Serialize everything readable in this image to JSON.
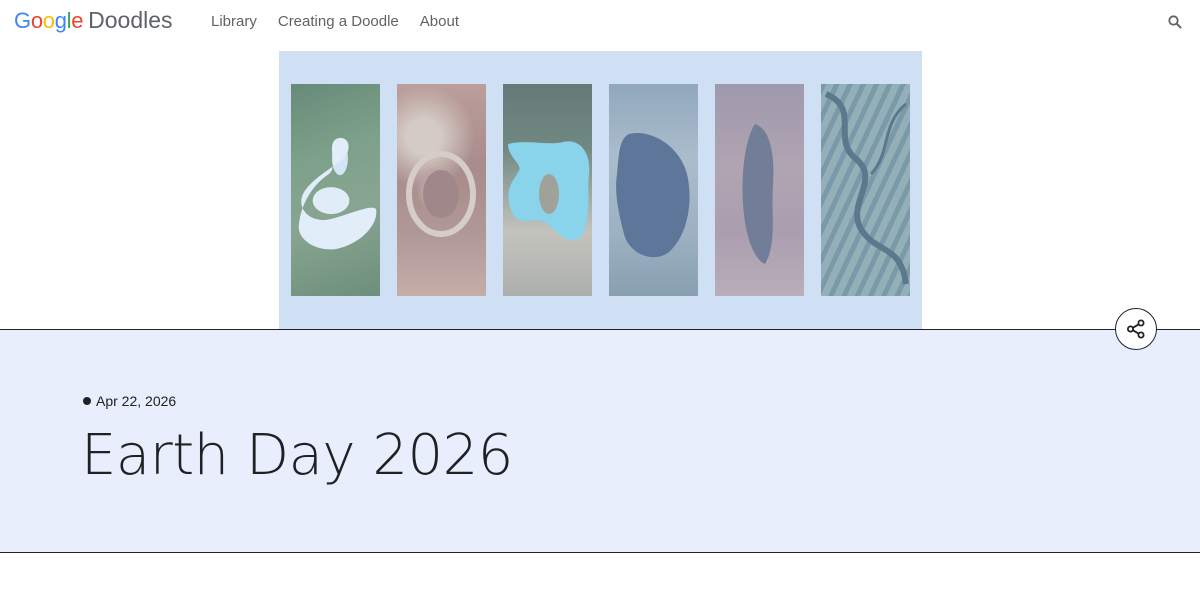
{
  "header": {
    "logo": {
      "google_letters": [
        {
          "char": "G",
          "color": "#4285F4"
        },
        {
          "char": "o",
          "color": "#EA4335"
        },
        {
          "char": "o",
          "color": "#FBBC05"
        },
        {
          "char": "g",
          "color": "#4285F4"
        },
        {
          "char": "l",
          "color": "#34A853"
        },
        {
          "char": "e",
          "color": "#EA4335"
        }
      ],
      "product": "Doodles"
    },
    "nav": [
      {
        "label": "Library"
      },
      {
        "label": "Creating a Doodle"
      },
      {
        "label": "About"
      }
    ],
    "search_icon": "search-icon"
  },
  "hero": {
    "panels": [
      "lake-satellite-panel",
      "crater-satellite-panel",
      "turquoise-lake-satellite-panel",
      "dark-lake-satellite-panel",
      "desert-satellite-panel",
      "river-delta-satellite-panel"
    ]
  },
  "doodle": {
    "date": "Apr 22, 2026",
    "title": "Earth Day 2026",
    "share_icon": "share-icon"
  },
  "colors": {
    "hero_background": "#cfe0f5",
    "info_background": "#e8eefb",
    "text": "#202124",
    "nav_text": "#5f6368"
  }
}
